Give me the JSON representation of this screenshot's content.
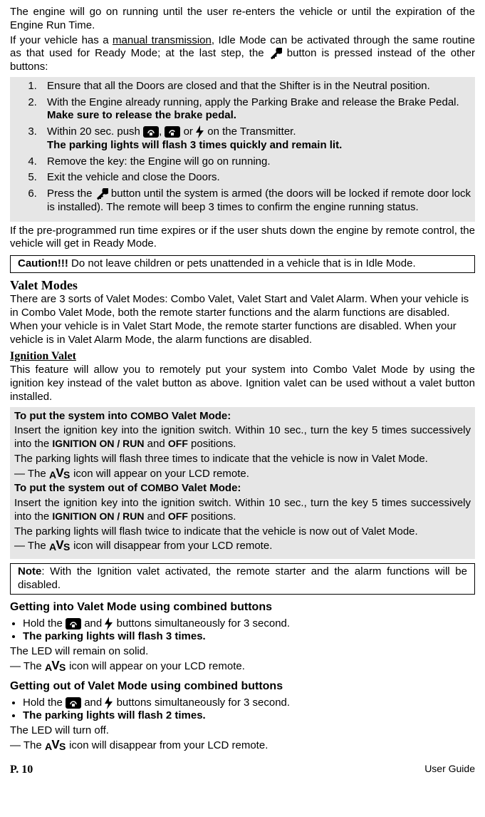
{
  "intro1": "The engine will go on running until the user re-enters the vehicle or until the expiration of the Engine Run Time.",
  "intro2_a": "If your vehicle has a ",
  "intro2_link": "manual transmission",
  "intro2_b": ", Idle Mode can be activated through the same routine as that used for Ready Mode; at the last step, the ",
  "intro2_c": " button is pressed instead of the other buttons:",
  "list": {
    "i1": "Ensure that all the Doors are closed and that the Shifter is in the Neutral position.",
    "i2a": "With the Engine already running, apply the Parking Brake and release the Brake Pedal.",
    "i2b": "Make sure to release the brake pedal.",
    "i3a": "Within 20 sec. push ",
    "i3mid": ", ",
    "i3or": " or ",
    "i3b": " on the Transmitter.",
    "i3c": "The parking lights will flash 3 times quickly and remain lit.",
    "i4": "Remove the key: the Engine will go on running.",
    "i5": "Exit the vehicle and close the Doors.",
    "i6a": "Press the ",
    "i6b": " button until the system is armed (the doors will be locked if remote door lock is installed). The remote will beep 3 times to confirm the engine running status."
  },
  "after_list": "If the pre-programmed run time expires or if the user shuts down the engine by remote control, the vehicle will get in Ready Mode.",
  "caution_label": "Caution!!!",
  "caution_text": " Do not leave children or pets unattended in a vehicle that is in Idle Mode.",
  "vm_title": "Valet Modes",
  "vm_p1": "There are 3 sorts of Valet Modes: Combo Valet, Valet Start and Valet Alarm. When your vehicle is in Combo Valet Mode, both the remote starter functions and the alarm functions are disabled. When your vehicle is in Valet Start Mode, the remote starter functions are disabled. When your vehicle is in Valet Alarm Mode, the alarm functions are disabled.",
  "iv_title": "Ignition Valet",
  "iv_p1": "This feature will allow you to remotely put your system into Combo Valet Mode by using the ignition key instead of the valet button as above. Ignition valet can be used without a valet button installed.",
  "combo_in_t1a": "To put the system into ",
  "combo_in_t1b": "COMBO",
  "combo_in_t1c": " Valet Mode:",
  "combo_in_p1a": "Insert the ignition key into the ignition switch. Within 10 sec., turn the key 5 times successively into the ",
  "combo_in_p1b": "IGNITION ON / RUN",
  "combo_in_p1c": " and ",
  "combo_in_p1d": "OFF",
  "combo_in_p1e": " positions.",
  "combo_in_p2": "The parking lights will flash three times to indicate that the vehicle is now in Valet Mode.",
  "combo_in_p3a": "— The ",
  "combo_in_p3b": " icon will appear on your LCD remote.",
  "combo_out_t1a": "To put the system out of ",
  "combo_out_t1b": "COMBO",
  "combo_out_t1c": " Valet Mode:",
  "combo_out_p1a": "Insert the ignition key into the ignition switch. Within 10 sec., turn the key 5 times successively into the ",
  "combo_out_p1b": "IGNITION ON / RUN",
  "combo_out_p1c": " and ",
  "combo_out_p1d": "OFF",
  "combo_out_p1e": " positions.",
  "combo_out_p2": "The parking lights will flash twice to indicate that the vehicle is now out of Valet Mode.",
  "combo_out_p3a": "— The ",
  "combo_out_p3b": " icon will disappear from your LCD remote.",
  "note_label": "Note",
  "note_text": ": With the Ignition valet activated, the remote starter and the alarm functions will be disabled.",
  "get_in_title": "Getting into Valet Mode using combined buttons",
  "get_in_b1a": "Hold the ",
  "get_in_b1b": " and ",
  "get_in_b1c": " buttons simultaneously for 3 second.",
  "get_in_b2": "The parking lights will flash 3 times.",
  "get_in_p1": "The LED will remain on solid.",
  "get_in_p2a": "— The ",
  "get_in_p2b": " icon will appear on your LCD remote.",
  "get_out_title": "Getting out of Valet Mode using combined buttons",
  "get_out_b1a": "Hold the ",
  "get_out_b1b": " and ",
  "get_out_b1c": " buttons simultaneously for 3 second.",
  "get_out_b2": "The parking lights will flash 2 times.",
  "get_out_p1": "The LED will turn off.",
  "get_out_p2a": "— The ",
  "get_out_p2b": " icon will disappear from your LCD remote.",
  "page": "P. 10",
  "guide": "User Guide"
}
